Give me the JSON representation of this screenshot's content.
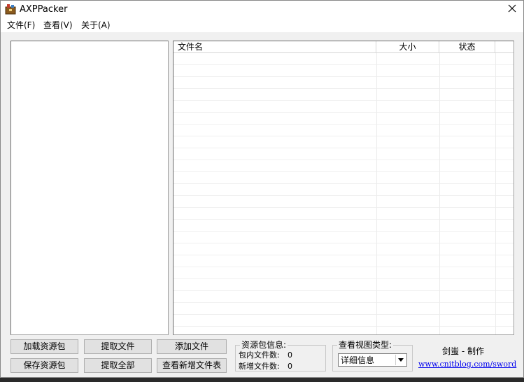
{
  "window": {
    "title": "AXPPacker",
    "icon": "archive-icon",
    "close_icon": "close-icon"
  },
  "menu": {
    "items": [
      {
        "label": "文件(F)"
      },
      {
        "label": "查看(V)"
      },
      {
        "label": "关于(A)"
      }
    ]
  },
  "list": {
    "columns": [
      {
        "label": "文件名"
      },
      {
        "label": "大小"
      },
      {
        "label": "状态"
      }
    ],
    "rows": []
  },
  "buttons": {
    "load": "加载资源包",
    "save": "保存资源包",
    "extract_file": "提取文件",
    "extract_all": "提取全部",
    "add_file": "添加文件",
    "view_new": "查看新增文件表"
  },
  "package_info": {
    "legend": "资源包信息:",
    "inner_count_label": "包内文件数:",
    "inner_count": "0",
    "new_count_label": "新增文件数:",
    "new_count": "0"
  },
  "view_type": {
    "legend": "查看视图类型:",
    "selected": "详细信息"
  },
  "credits": {
    "author": "剑蚩 - 制作",
    "link": "www.cnitblog.com/sword"
  },
  "colors": {
    "window_bg": "#f0f0f0",
    "link": "#0000ee"
  }
}
